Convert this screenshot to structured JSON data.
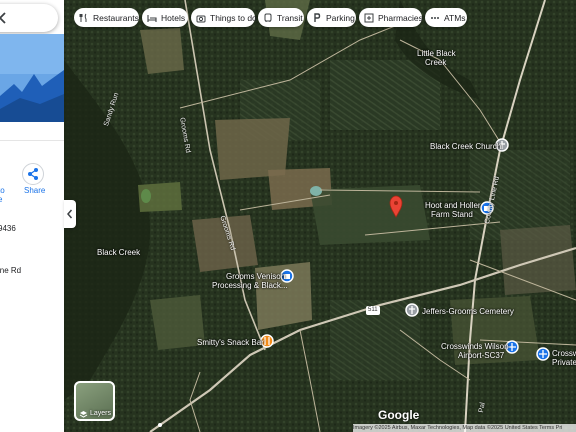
{
  "search": {
    "close_icon": "close-icon"
  },
  "panel": {
    "route_fragment_1": "to",
    "route_fragment_2": "e",
    "share_label": "Share",
    "phone_fragment": "9436",
    "address_fragment": "ine Rd"
  },
  "chips": [
    {
      "label": "Restaurants",
      "icon": "restaurant-icon"
    },
    {
      "label": "Hotels",
      "icon": "hotel-icon"
    },
    {
      "label": "Things to do",
      "icon": "camera-icon"
    },
    {
      "label": "Transit",
      "icon": "transit-icon"
    },
    {
      "label": "Parking",
      "icon": "parking-icon"
    },
    {
      "label": "Pharmacies",
      "icon": "pharmacy-icon"
    },
    {
      "label": "ATMs",
      "icon": "atm-icon"
    }
  ],
  "map": {
    "places": {
      "little_black_creek_1": "Little Black",
      "little_black_creek_2": "Creek",
      "black_creek_church": "Black Creek Church",
      "hoot_holler_1": "Hoot and Holler",
      "hoot_holler_2": "Farm Stand",
      "black_creek": "Black Creek",
      "grooms_1": "Grooms Venison",
      "grooms_2": "Processing & Black...",
      "jeffers_cemetery": "Jeffers-Grooms Cemetery",
      "smittys": "Smitty's Snack Bar",
      "crosswinds_1": "Crosswinds Wilson",
      "crosswinds_2": "Airport-SC37",
      "crossw_frag_1": "Crossw",
      "crossw_frag_2": "Private"
    },
    "roads": {
      "sandy_run": "Sandy Run",
      "grooms_rd": "Grooms Rd",
      "grooms_rd_2": "Grooms Rd",
      "county_line_rd": "County Line Rd",
      "route_511": "511",
      "pal_frag": "Pal"
    },
    "colors": {
      "pin": "#ea4335",
      "poi_blue": "#1a73e8",
      "poi_orange": "#f28b1a",
      "poi_gray": "#9aa0a6"
    }
  },
  "layers_label": "Layers",
  "google_logo": "Google",
  "attribution": "Imagery ©2025 Airbus, Maxar Technologies, Map data ©2025   United States   Terms   Pri"
}
